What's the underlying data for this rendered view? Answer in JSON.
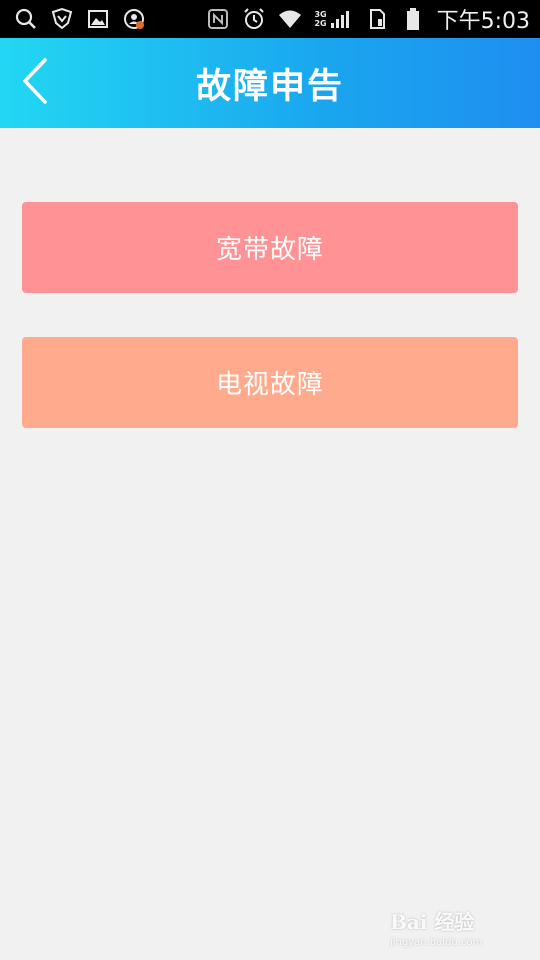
{
  "status_bar": {
    "icons_left": [
      "search-icon",
      "shield-icon",
      "image-icon",
      "user-badge-icon"
    ],
    "icons_right": [
      "nfc-icon",
      "alarm-icon",
      "wifi-icon",
      "signal-icon",
      "sim-icon",
      "battery-icon"
    ],
    "network_top": "3G",
    "network_bottom": "2G",
    "time": "下午5:03"
  },
  "header": {
    "title": "故障申告",
    "back_icon": "chevron-left-icon",
    "gradient_start": "#23d7f3",
    "gradient_end": "#1e8ff0"
  },
  "buttons": {
    "broadband_label": "宽带故障",
    "broadband_color": "#ff9294",
    "tv_label": "电视故障",
    "tv_color": "#ffaa8c"
  },
  "watermark": {
    "text": "Bai 经验",
    "subtext": "jingyan.baidu.com"
  }
}
